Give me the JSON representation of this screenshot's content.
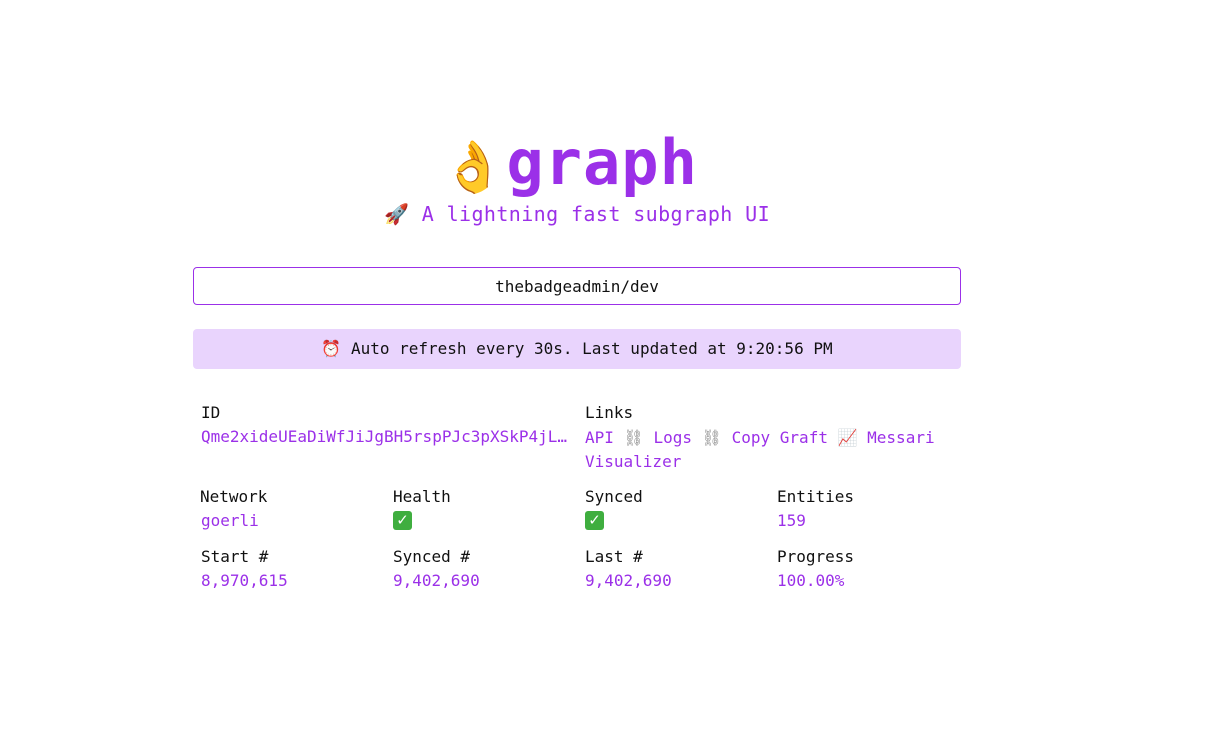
{
  "header": {
    "logo_emoji": "👌",
    "logo_text": "graph",
    "tagline_icon": "🚀",
    "tagline": "A lightning fast subgraph UI"
  },
  "search": {
    "value": "thebadgeadmin/dev"
  },
  "status": {
    "icon": "⏰",
    "text": "Auto refresh every 30s. Last updated at 9:20:56 PM"
  },
  "details": {
    "id": {
      "label": "ID",
      "value": "Qme2xideUEaDiWfJiJgBH5rspPJc3pXSkP4jL…"
    },
    "links": {
      "label": "Links",
      "api": "API",
      "sep1": "⛓",
      "logs": "Logs",
      "sep2": "⛓",
      "copy_graft": "Copy Graft",
      "messari_icon": "📈",
      "messari": "Messari Visualizer"
    },
    "network": {
      "label": "Network",
      "value": "goerli"
    },
    "health": {
      "label": "Health",
      "icon": "check-icon"
    },
    "synced": {
      "label": "Synced",
      "icon": "check-icon"
    },
    "entities": {
      "label": "Entities",
      "value": "159"
    },
    "start_block": {
      "label": "Start #",
      "value": "8,970,615"
    },
    "synced_block": {
      "label": "Synced #",
      "value": "9,402,690"
    },
    "last_block": {
      "label": "Last #",
      "value": "9,402,690"
    },
    "progress": {
      "label": "Progress",
      "value": "100.00%"
    }
  },
  "colors": {
    "accent": "#9b30e8",
    "banner_bg": "#e9d4fd",
    "check_green": "#3fae3f"
  }
}
